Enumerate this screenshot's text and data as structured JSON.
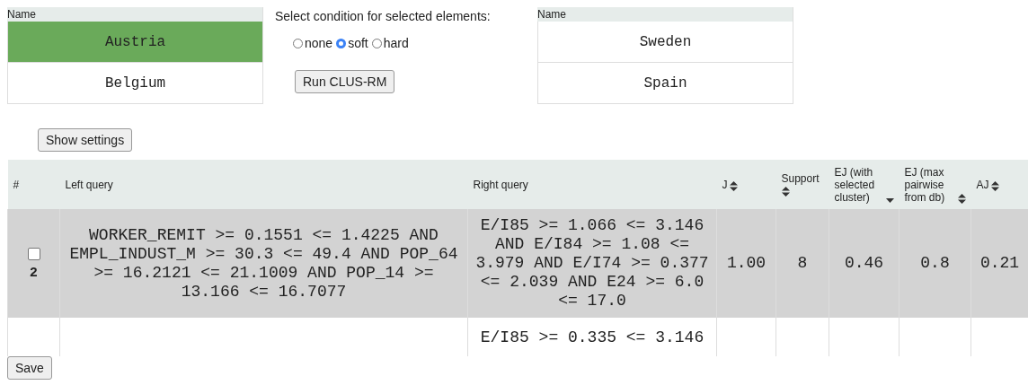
{
  "left_list": {
    "header": "Name",
    "items": [
      {
        "label": "Austria",
        "selected": true
      },
      {
        "label": "Belgium",
        "selected": false
      }
    ]
  },
  "condition": {
    "label": "Select condition for selected elements:",
    "options": [
      {
        "label": "none",
        "selected": false
      },
      {
        "label": "soft",
        "selected": true
      },
      {
        "label": "hard",
        "selected": false
      }
    ],
    "run_button": "Run CLUS-RM"
  },
  "right_list": {
    "header": "Name",
    "items": [
      {
        "label": "Sweden",
        "selected": false
      },
      {
        "label": "Spain",
        "selected": false
      }
    ]
  },
  "settings_button": "Show settings",
  "table": {
    "columns": [
      {
        "label": "#",
        "sortable": false
      },
      {
        "label": "Left query",
        "sortable": false
      },
      {
        "label": "Right query",
        "sortable": false
      },
      {
        "label": "J",
        "sortable": true,
        "sorted": false
      },
      {
        "label": "Support",
        "sortable": true,
        "sorted": false
      },
      {
        "label": "EJ (with selected cluster)",
        "sortable": true,
        "sorted": true
      },
      {
        "label": "EJ (max pairwise from db)",
        "sortable": true,
        "sorted": false
      },
      {
        "label": "AJ",
        "sortable": true,
        "sorted": false
      }
    ],
    "rows": [
      {
        "selected": true,
        "checked": false,
        "number": "2",
        "left_query": "WORKER_REMIT >= 0.1551 <= 1.4225 AND EMPL_INDUST_M >= 30.3 <= 49.4 AND POP_64 >= 16.2121 <= 21.1009 AND POP_14 >= 13.166 <= 16.7077",
        "right_query": "E/I85 >= 1.066 <= 3.146 AND E/I84 >= 1.08 <= 3.979 AND E/I74 >= 0.377 <= 2.039 AND E24 >= 6.0 <= 17.0",
        "j": "1.00",
        "support": "8",
        "ej_selected": "0.46",
        "ej_max": "0.8",
        "aj": "0.21"
      },
      {
        "selected": false,
        "right_query": "E/I85 >= 0.335 <= 3.146"
      }
    ]
  },
  "save_button": "Save"
}
